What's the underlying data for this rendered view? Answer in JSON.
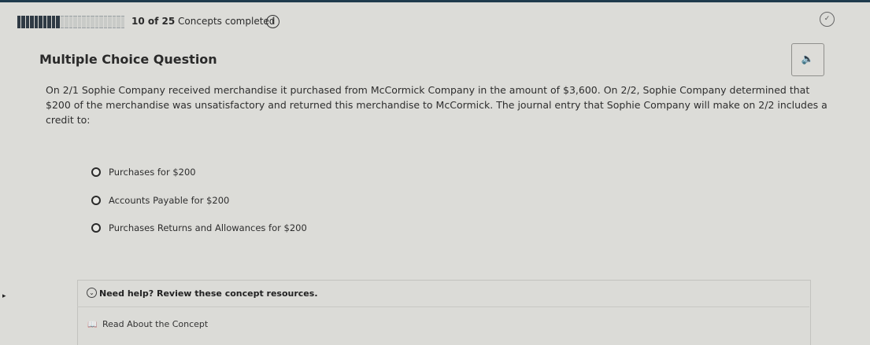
{
  "progress": {
    "completed": 10,
    "total": 25,
    "count_label": "10 of 25",
    "suffix_label": "Concepts completed"
  },
  "question": {
    "type_label": "Multiple Choice Question",
    "text": "On 2/1 Sophie Company received merchandise it purchased from McCormick Company in the amount of $3,600. On 2/2, Sophie Company determined that $200 of the merchandise was unsatisfactory and returned this merchandise to McCormick. The journal entry that Sophie Company will make on 2/2 includes a credit to:",
    "options": [
      {
        "label": "Purchases for $200"
      },
      {
        "label": "Accounts Payable for $200"
      },
      {
        "label": "Purchases Returns and Allowances for $200"
      }
    ]
  },
  "help": {
    "title": "Need help? Review these concept resources.",
    "resources": [
      {
        "label": "Read About the Concept",
        "icon": "book-icon"
      }
    ]
  },
  "icons": {
    "info": "info-icon",
    "status": "status-icon",
    "speaker": "speaker-icon",
    "toggle": "chevron-down-icon"
  },
  "colors": {
    "background": "#dcdcd8",
    "progress_filled": "#2f3a44",
    "progress_empty": "#c9cbc8",
    "top_bar": "#1f3b4d"
  }
}
